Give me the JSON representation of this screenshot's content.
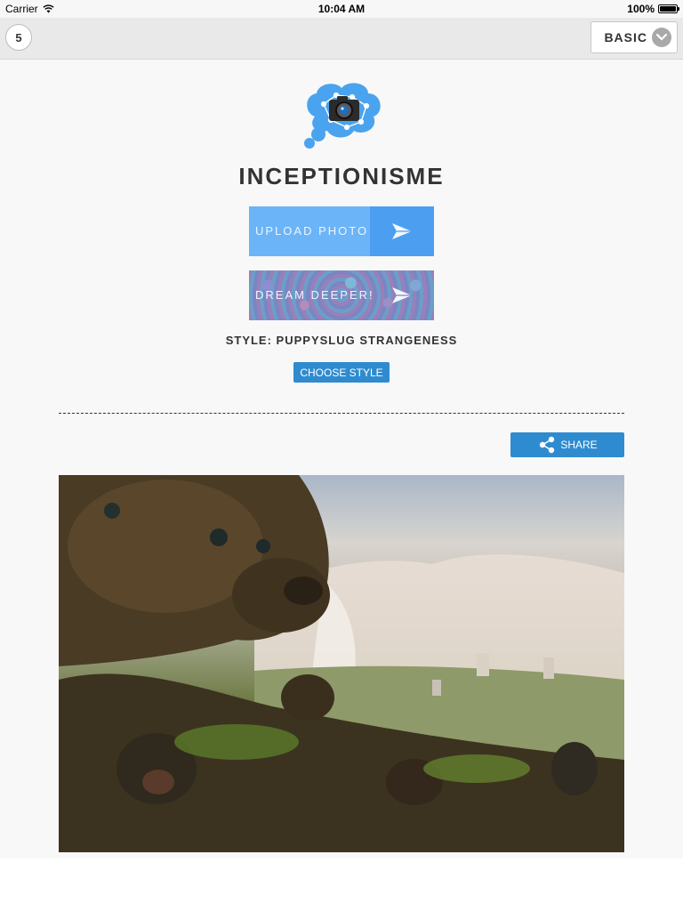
{
  "status_bar": {
    "carrier": "Carrier",
    "time": "10:04 AM",
    "battery": "100%"
  },
  "toolbar": {
    "count": "5",
    "mode": "BASIC"
  },
  "app": {
    "title": "INCEPTIONISME",
    "upload_label": "UPLOAD PHOTO",
    "dream_label": "DREAM DEEPER!",
    "style_text": "STYLE: PUPPYSLUG STRANGENESS",
    "choose_style_label": "CHOOSE STYLE",
    "share_label": "SHARE"
  },
  "colors": {
    "accent": "#2f8bd0",
    "upload_button": "#6ab4f7",
    "logo_cloud": "#4aa3ee"
  },
  "icons": {
    "toolbar": "chevron-down-icon",
    "buttons": "paper-plane-icon",
    "share": "share-icon",
    "logo": "brain-camera-logo"
  }
}
